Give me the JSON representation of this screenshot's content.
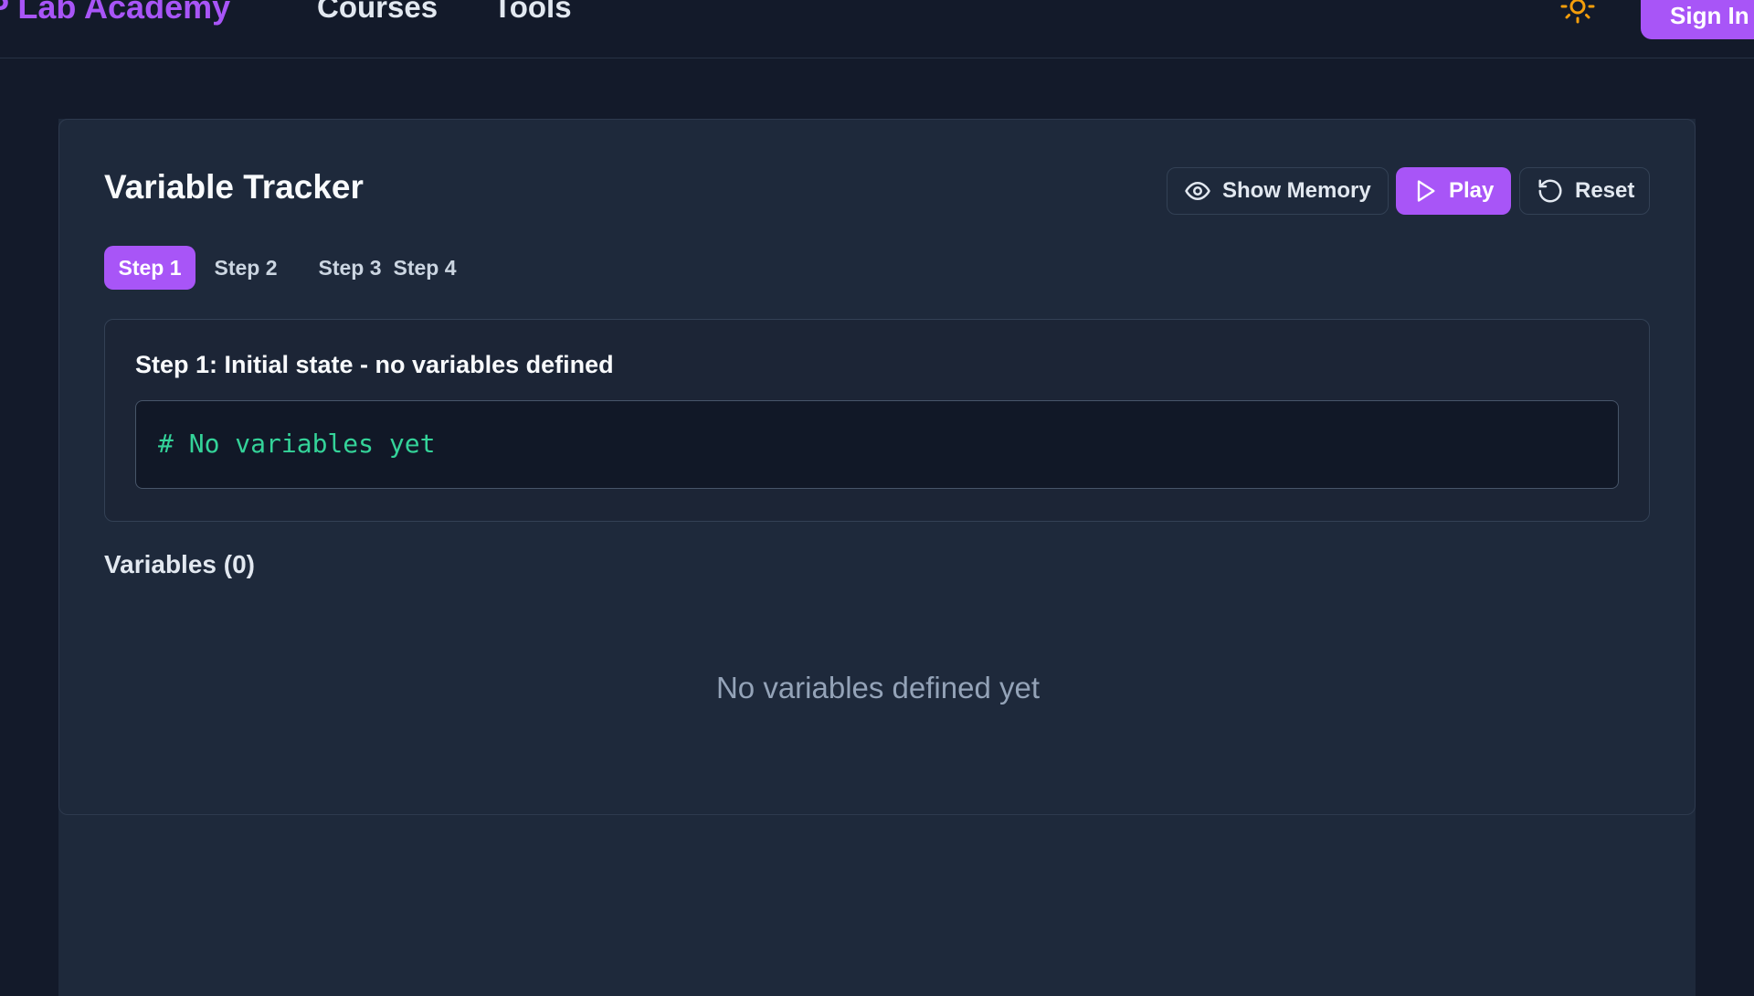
{
  "header": {
    "brand": "P Lab Academy",
    "nav": [
      {
        "label": "Courses"
      },
      {
        "label": "Tools"
      }
    ],
    "theme_icon": "sun-icon",
    "sign_in_label": "Sign In"
  },
  "tracker": {
    "title": "Variable Tracker",
    "buttons": {
      "show_memory": "Show Memory",
      "play": "Play",
      "reset": "Reset"
    },
    "steps": [
      {
        "label": "Step 1",
        "active": true
      },
      {
        "label": "Step 2",
        "active": false
      },
      {
        "label": "Step 3",
        "active": false
      },
      {
        "label": "Step 4",
        "active": false
      }
    ],
    "current_step": {
      "description": "Step 1: Initial state - no variables defined",
      "code": "# No variables yet"
    },
    "variables_heading": "Variables (0)",
    "empty_message": "No variables defined yet"
  },
  "colors": {
    "accent": "#a855f7",
    "page_bg": "#131a2a",
    "card_bg": "#1e293b",
    "code_text": "#34d399",
    "sun": "#f59e0b"
  }
}
